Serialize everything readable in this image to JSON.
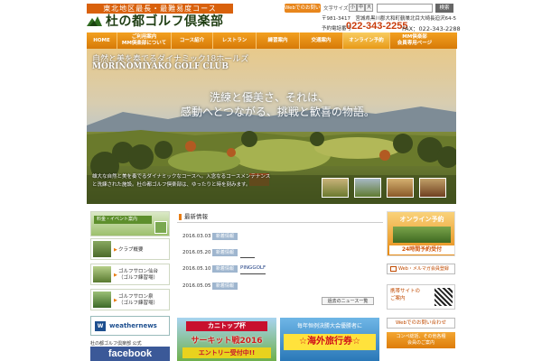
{
  "header": {
    "tagline": "東北地区最長・最難易度コース",
    "logo_text": "杜の都ゴルフ倶楽部",
    "web_contact": "Webでのお問い合わせ",
    "font_size_label": "文字サイズ",
    "font_sizes": [
      "小",
      "中",
      "大"
    ],
    "search_placeholder": "",
    "search_button": "検索",
    "address": "〒981-3417　宮城県黒川郡大和町鶴巣北目大崎長迫沢64-5",
    "phone_label": "予約電話番号",
    "phone": "022-343-2255",
    "fax": "FAX：022-343-2288"
  },
  "nav": {
    "items": [
      {
        "label": "HOME"
      },
      {
        "label": "ご利用案内\nMM倶楽部について"
      },
      {
        "label": "コース紹介"
      },
      {
        "label": "レストラン"
      },
      {
        "label": "練習案内"
      },
      {
        "label": "交通案内"
      },
      {
        "label": "オンライン予約"
      },
      {
        "label": "MM倶楽部\n会員専用ページ"
      }
    ],
    "active_index": 6
  },
  "hero": {
    "title_jp": "自然と美を奏でるダイナミック18ホールズ",
    "title_en": "MORINOMIYAKO GOLF CLUB",
    "line1": "洗練と優美さ、それは、",
    "line2": "感動へとつながる、挑戦と歓喜の物語。",
    "description": "雄大な自然と美を奏でるダイナミックなコースへ。入念なるコースメンテナンスと洗練された施設。杜の都ゴルフ倶楽部は、ゆったりと時を刻みます。"
  },
  "left": {
    "event_banner": "料金・イベント案内",
    "items": [
      {
        "label": "クラブ概要"
      },
      {
        "label": "ゴルフサロン仙台\n（ゴルフ練習場）"
      },
      {
        "label": "ゴルフサロン泉\n（ゴルフ練習場）"
      }
    ],
    "weathernews": "weathernews",
    "fb_label": "杜の都ゴルフ倶楽部 公式",
    "facebook": "facebook"
  },
  "news": {
    "title": "最新情報",
    "tag": "新着情報",
    "rows": [
      {
        "date": "2016.03.03",
        "text": ""
      },
      {
        "date": "2016.05.20",
        "text": "         "
      },
      {
        "date": "2016.05.10",
        "text": "PINGGOLF"
      },
      {
        "date": "2016.05.05",
        "text": ""
      }
    ],
    "more": "過去のニュース一覧"
  },
  "banners": {
    "cani_top": "カニトップ杯",
    "cani_mid": "サーキット戦2016",
    "cani_bottom": "エントリー受付中!!",
    "travel_top": "毎年恒例決勝大会優勝者に",
    "travel_mid": "☆海外旅行券☆"
  },
  "right": {
    "online_title": "オンライン予約",
    "online_sub": "24時間予約受付",
    "mail": "Web・メルマガ会員登録",
    "mobile_title": "携帯サイトの\nご案内",
    "web_contact": "Webでのお問い合わせ",
    "member": "コンペ総括、その他各種\n会員のご案内"
  },
  "colors": {
    "accent": "#e87d14",
    "nav_bg": "#d77a08",
    "phone": "#c93b0a",
    "logo": "#1e3d12",
    "facebook": "#3b5998"
  }
}
